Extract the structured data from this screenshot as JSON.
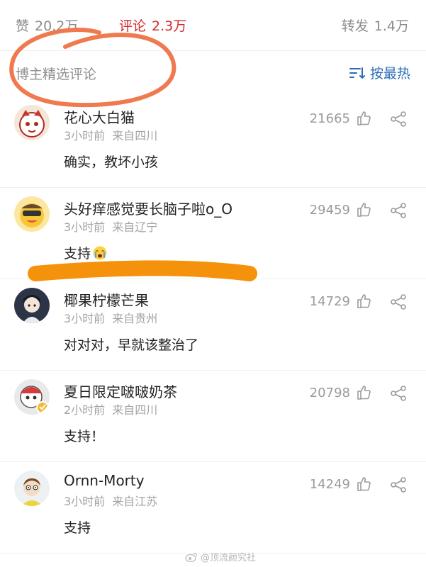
{
  "stats": {
    "likes_label": "赞",
    "likes_value": "20.2万",
    "comments_label": "评论",
    "comments_value": "2.3万",
    "reposts_label": "转发",
    "reposts_value": "1.4万",
    "active_color": "#d22a2a"
  },
  "filter": {
    "title": "博主精选评论",
    "sort_label": "按最热",
    "sort_color": "#2b6db3"
  },
  "comments": [
    {
      "username": "花心大白猫",
      "time": "3小时前",
      "location": "来自四川",
      "text": "确实，教坏小孩",
      "likes": "21665",
      "avatar_icon": "cat-avatar-icon"
    },
    {
      "username": "头好痒感觉要长脑子啦o_O",
      "time": "3小时前",
      "location": "来自辽宁",
      "text": "支持",
      "likes": "29459",
      "avatar_icon": "duck-avatar-icon",
      "emoji": "crying-face-emoji"
    },
    {
      "username": "椰果柠檬芒果",
      "time": "3小时前",
      "location": "来自贵州",
      "text": "对对对，早就该整治了",
      "likes": "14729",
      "avatar_icon": "anime-avatar-icon"
    },
    {
      "username": "夏日限定啵啵奶茶",
      "time": "2小时前",
      "location": "来自四川",
      "text": "支持！",
      "likes": "20798",
      "avatar_icon": "cartoon-avatar-icon"
    },
    {
      "username": "Ornn-Morty",
      "time": "3小时前",
      "location": "来自江苏",
      "text": "支持",
      "likes": "14249",
      "avatar_icon": "morty-avatar-icon"
    }
  ],
  "watermark": "@顶流颜究社",
  "annotations": {
    "circle_color": "#f07a4f",
    "underline_color": "#f5920c"
  }
}
